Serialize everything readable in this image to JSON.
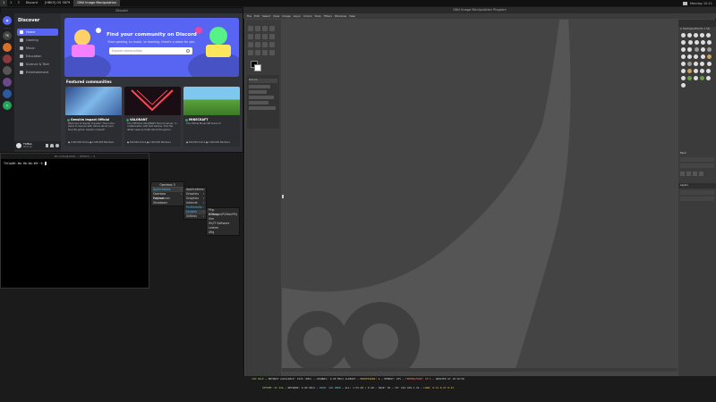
{
  "topbar": {
    "workspaces": [
      "1",
      "2",
      "3"
    ],
    "tasks": [
      "Discord",
      "[HBK3] OS 3879",
      "GNU Image Manipulation"
    ],
    "clock": "Monday 10:11"
  },
  "discord": {
    "window_title": "Discord",
    "sidebar_title": "Discover",
    "nav": [
      "Home",
      "Gaming",
      "Music",
      "Education",
      "Science & Tech",
      "Entertainment"
    ],
    "hero_title": "Find your community on Discord",
    "hero_subtitle": "From gaming, to music, to learning, there's a place for you.",
    "search_placeholder": "Explore communities",
    "featured_title": "Featured communities",
    "cards": [
      {
        "name": "Genshin Impact Official",
        "desc": "Welcome to Teyvat, Traveler! This is the place to discuss with others about your favorite game: Genshin Impact!",
        "stats": "● 1,000,000 Online  ● 1,000,000 Members"
      },
      {
        "name": "VALORANT",
        "desc": "The OFFICIAL VALORANT Discord server, in collaboration with Riot Games. Find the latest news and talk about the game!",
        "stats": "● 200,000 Online  ● 1,000,000 Members"
      },
      {
        "name": "MINECRAFT",
        "desc": "The official Minecraft Discord!",
        "stats": "● 200,000 Online  ● 1,000,000 Members"
      }
    ],
    "user": {
      "name": "TkMan",
      "status": "Online"
    }
  },
  "terminal": {
    "title": "MicroHal@4000 ~ [MHK3] ~ $",
    "prompt": "TkCopBt-Wa-Hb-Wa-WH:~$ "
  },
  "openbox": {
    "title": "Openbox 3",
    "items": [
      "Applications",
      "Openbox Preferences",
      "Log out",
      "Shutdown"
    ],
    "sub1": [
      "Applications",
      "Graphics",
      "Graphics",
      "Internet",
      "Multimedia",
      "System",
      "Utilities"
    ],
    "sub2": [
      "Pkg-Manager(PCManFM)",
      "X Term",
      "Vim",
      "XV/IT Software",
      "Lxterm",
      "Xfig"
    ]
  },
  "gimp": {
    "title": "GNU Image Manipulation Program",
    "menus": [
      "File",
      "Edit",
      "Select",
      "View",
      "Image",
      "Layer",
      "Colors",
      "Tools",
      "Filters",
      "Windows",
      "Help"
    ],
    "brush_label": "2. Hardness 050 (51 × 51)",
    "brush_category": "Basic",
    "layers_label": "Layers",
    "mode": "Normal"
  },
  "status": {
    "line1_a": "CPU IDLE",
    "line1_b": "  ~  ENTROPY AVAILABLE: 3236 (98%)  ~  CHANNEL: 0.00 MB/S ALREADY  ~  ",
    "line1_c": "PROCESSORS: 4",
    "line1_d": "  ~  MEMORY: 25%  ~  ",
    "line1_e": "TEMPERATURE: 45°C",
    "line1_f": "  ~  UPDATED AT 10:10:58",
    "line2_a": "UPTIME: 5h 22m",
    "line2_b": "  ~  NETWORK: 0.00 KB/S  ~  ",
    "line2_c": "DISK: 12% USED",
    "line2_d": "  ~  ALL: 1.54 GB / 8 GB  ~  SWAP: 0%  ~  IP: 192.168.1.34  ~  ",
    "line2_e": "LOAD: 0.31 0.27 0.23"
  },
  "colors": {
    "discord_blurple": "#5865f2",
    "gimp_bg": "#454545",
    "status_green": "#9fd35d"
  }
}
